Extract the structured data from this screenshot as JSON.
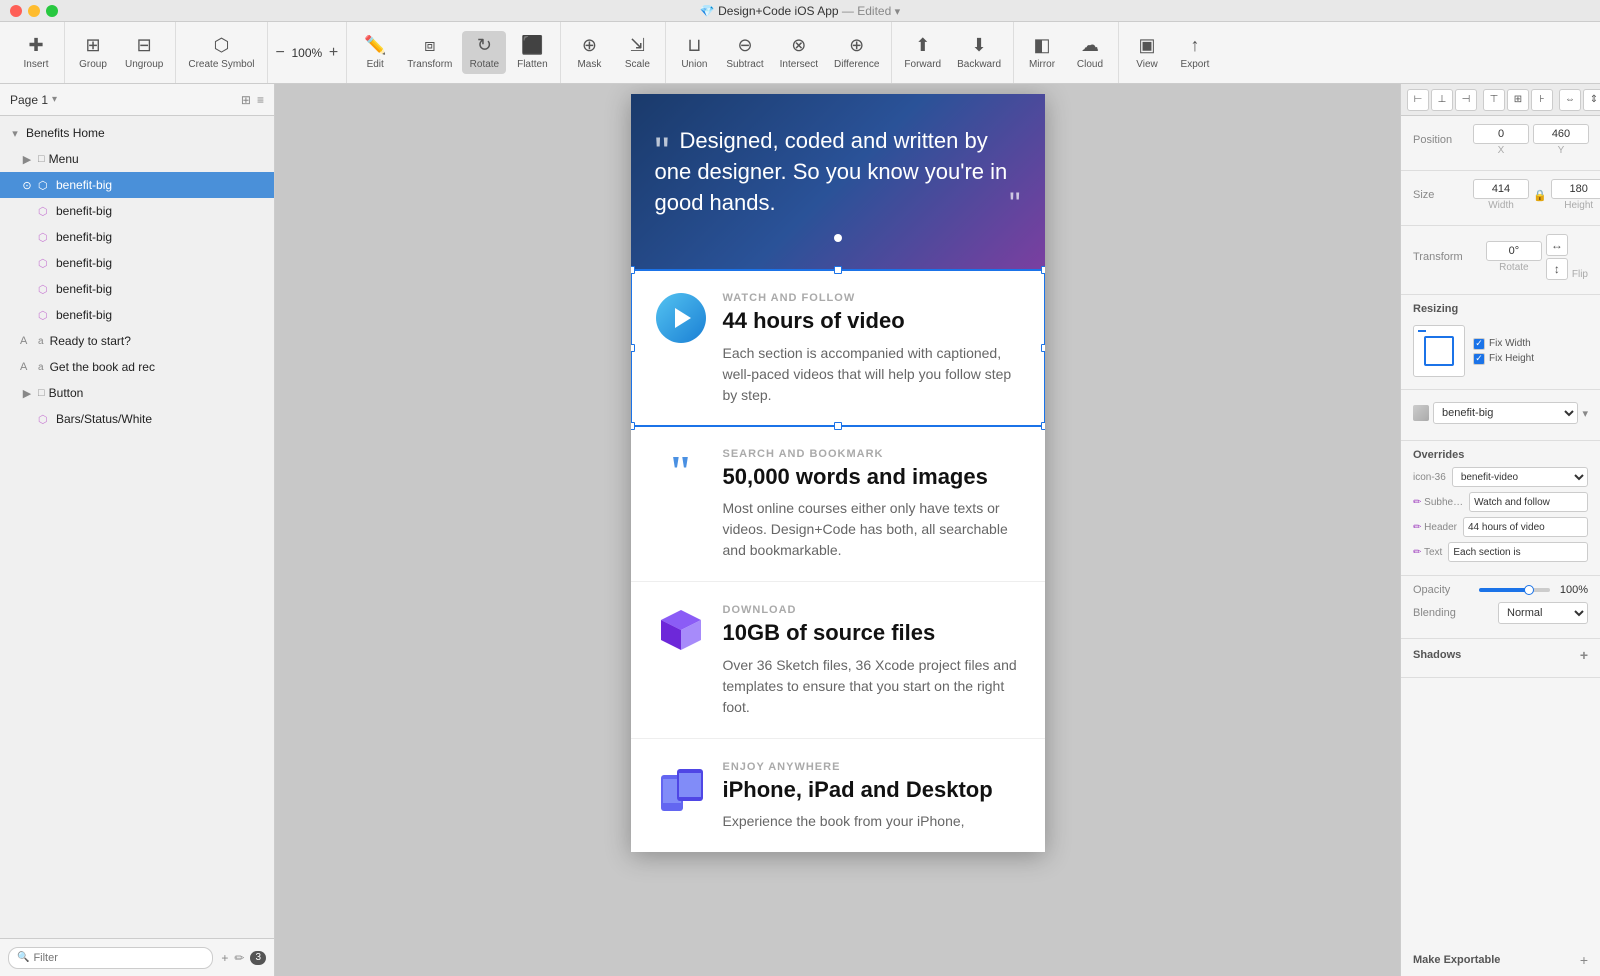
{
  "titlebar": {
    "title": "Design+Code iOS App",
    "edited": "— Edited",
    "icon": "💎"
  },
  "toolbar": {
    "insert_label": "Insert",
    "group_label": "Group",
    "ungroup_label": "Ungroup",
    "create_symbol_label": "Create Symbol",
    "zoom_minus": "−",
    "zoom_value": "100%",
    "zoom_plus": "+",
    "edit_label": "Edit",
    "transform_label": "Transform",
    "rotate_label": "Rotate",
    "flatten_label": "Flatten",
    "mask_label": "Mask",
    "scale_label": "Scale",
    "union_label": "Union",
    "subtract_label": "Subtract",
    "intersect_label": "Intersect",
    "difference_label": "Difference",
    "forward_label": "Forward",
    "backward_label": "Backward",
    "mirror_label": "Mirror",
    "cloud_label": "Cloud",
    "view_label": "View",
    "export_label": "Export"
  },
  "left_panel": {
    "page_label": "Page 1",
    "root_item": "Benefits Home",
    "tree_items": [
      {
        "label": "Menu",
        "type": "group",
        "indent": 1
      },
      {
        "label": "benefit-big",
        "type": "symbol",
        "indent": 1,
        "selected": true
      },
      {
        "label": "benefit-big",
        "type": "symbol",
        "indent": 1
      },
      {
        "label": "benefit-big",
        "type": "symbol",
        "indent": 1
      },
      {
        "label": "benefit-big",
        "type": "symbol",
        "indent": 1
      },
      {
        "label": "benefit-big",
        "type": "symbol",
        "indent": 1
      },
      {
        "label": "benefit-big",
        "type": "symbol",
        "indent": 1
      },
      {
        "label": "Ready to start?",
        "type": "text",
        "indent": 1
      },
      {
        "label": "Get the book ad rec",
        "type": "text",
        "indent": 1
      },
      {
        "label": "Button",
        "type": "group",
        "indent": 1
      },
      {
        "label": "Bars/Status/White",
        "type": "symbol",
        "indent": 1
      }
    ],
    "filter_placeholder": "Filter",
    "badge_count": "3"
  },
  "canvas": {
    "hero_quote": "Designed, coded and written by one designer. So you know you're in good hands.",
    "quote_open": "“",
    "quote_close": "”",
    "benefits": [
      {
        "eyebrow": "WATCH AND FOLLOW",
        "title": "44 hours of video",
        "desc": "Each section is accompanied with captioned, well-paced videos that will help you follow step by step.",
        "icon_type": "play"
      },
      {
        "eyebrow": "SEARCH AND BOOKMARK",
        "title": "50,000 words and images",
        "desc": "Most online courses either only have texts or videos. Design+Code has both, all searchable and bookmarkable.",
        "icon_type": "quote"
      },
      {
        "eyebrow": "DOWNLOAD",
        "title": "10GB of source files",
        "desc": "Over 36 Sketch files, 36 Xcode project files and templates to ensure that you start on the right foot.",
        "icon_type": "cube"
      },
      {
        "eyebrow": "ENJOY ANYWHERE",
        "title": "iPhone, iPad and Desktop",
        "desc": "Experience the book from your iPhone,",
        "icon_type": "devices"
      }
    ]
  },
  "inspector": {
    "tabs": [
      {
        "icon": "⊞",
        "active": false
      },
      {
        "icon": "⊟",
        "active": false
      },
      {
        "icon": "◫",
        "active": false
      },
      {
        "icon": "⊠",
        "active": false
      },
      {
        "icon": "⊡",
        "active": false
      },
      {
        "icon": "⊢",
        "active": false
      },
      {
        "icon": "⊣",
        "active": false
      },
      {
        "icon": "⊤",
        "active": false
      }
    ],
    "position_label": "Position",
    "pos_x": "0",
    "pos_y": "460",
    "pos_x_label": "X",
    "pos_y_label": "Y",
    "size_label": "Size",
    "size_w": "414",
    "size_h": "180",
    "size_w_label": "Width",
    "size_h_label": "Height",
    "transform_label": "Transform",
    "rotate_val": "0°",
    "rotate_label": "Rotate",
    "flip_label": "Flip",
    "resizing_label": "Resizing",
    "fix_width_label": "Fix Width",
    "fix_height_label": "Fix Height",
    "symbol_name": "benefit-big",
    "overrides_label": "Overrides",
    "override_items": [
      {
        "key": "icon-36",
        "value": "benefit-video",
        "type": "select"
      },
      {
        "key": "Subhe…",
        "value": "Watch and follow",
        "type": "text"
      },
      {
        "key": "Header",
        "value": "44 hours of video",
        "type": "text"
      },
      {
        "key": "Text",
        "value": "Each section is",
        "type": "text"
      }
    ],
    "opacity_label": "Opacity",
    "opacity_val": "100%",
    "blending_label": "Blending",
    "blending_val": "Normal",
    "shadows_label": "Shadows",
    "make_exportable_label": "Make Exportable"
  }
}
